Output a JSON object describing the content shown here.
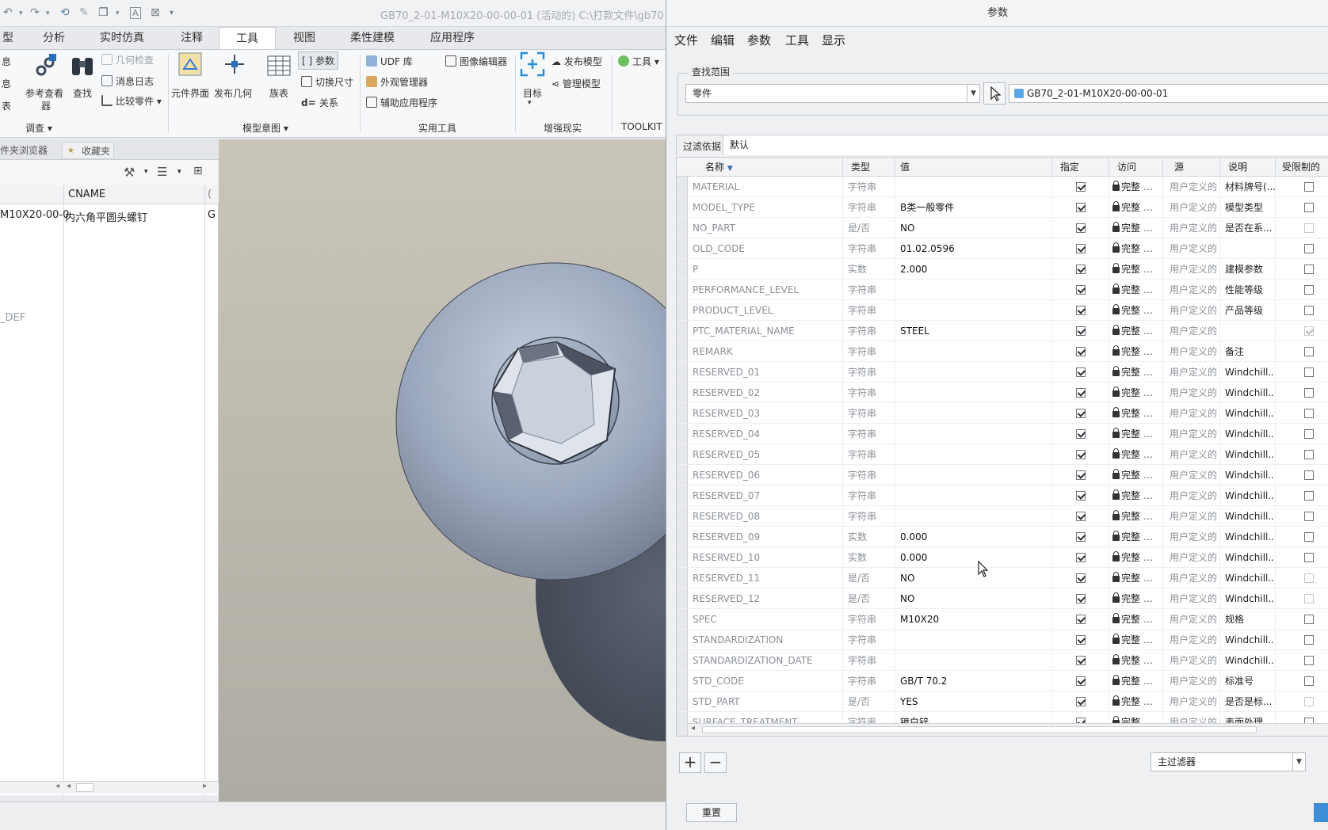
{
  "app": {
    "title": "GB70_2-01-M10X20-00-00-01 (活动的) C:\\打款文件\\gb70",
    "tabs": [
      {
        "label": "型"
      },
      {
        "label": "分析"
      },
      {
        "label": "实时仿真"
      },
      {
        "label": "注释"
      },
      {
        "label": "工具"
      },
      {
        "label": "视图"
      },
      {
        "label": "柔性建模"
      },
      {
        "label": "应用程序"
      }
    ],
    "ribbon": {
      "g1": {
        "item1": "息",
        "item2": "息",
        "item3": "表"
      },
      "investigate": {
        "ref_viewer_1": "参考查看",
        "ref_viewer_2": "器",
        "find": "查找",
        "geom_check": "几何检查",
        "msg_log": "消息日志",
        "compare": "比较零件",
        "label": "调查"
      },
      "model_intent": {
        "component_interface": "元件界面",
        "publish_geom": "发布几何",
        "family_table": "族表",
        "parameters": "参数",
        "switch_dims": "切换尺寸",
        "relations": "关系",
        "label": "模型意图"
      },
      "utilities": {
        "udf": "UDF 库",
        "appearance": "外观管理器",
        "aux_app": "辅助应用程序",
        "image_editor": "图像编辑器",
        "label": "实用工具"
      },
      "ar": {
        "target": "目标",
        "publish_model": "发布模型",
        "manage_model": "管理模型",
        "label": "增强现实"
      },
      "toolkit": {
        "tools": "工具",
        "label": "TOOLKIT"
      }
    },
    "navigator": {
      "tab1": "件夹浏览器",
      "tab2": "收藏夹",
      "col_cname": "CNAME",
      "row1_name": "M10X20-00-0",
      "row1_cname": "内六角平圆头螺钉",
      "row1_extra": "G",
      "row2_name": "_DEF"
    }
  },
  "dialog": {
    "title": "参数",
    "menu": [
      "文件",
      "编辑",
      "参数",
      "工具",
      "显示"
    ],
    "scope_label": "查找范围",
    "scope_value": "零件",
    "model_name": "GB70_2-01-M10X20-00-00-01",
    "filter_label": "过滤依据",
    "filter_value": "默认",
    "headers": {
      "name": "名称",
      "type": "类型",
      "value": "值",
      "designate": "指定",
      "access": "访问",
      "source": "源",
      "description": "说明",
      "restricted": "受限制的"
    },
    "access_text": "完整",
    "source_text": "用户定义的",
    "rows": [
      {
        "name": "MATERIAL",
        "type": "字符串",
        "value": "",
        "desc": "材料牌号(...",
        "restricted": false,
        "dim": false
      },
      {
        "name": "MODEL_TYPE",
        "type": "字符串",
        "value": "B类一般零件",
        "desc": "模型类型",
        "restricted": false,
        "dim": false
      },
      {
        "name": "NO_PART",
        "type": "是/否",
        "value": "NO",
        "desc": "是否在系...",
        "restricted": false,
        "dim": true
      },
      {
        "name": "OLD_CODE",
        "type": "字符串",
        "value": "01.02.0596",
        "desc": "",
        "restricted": false,
        "dim": false
      },
      {
        "name": "P",
        "type": "实数",
        "value": "2.000",
        "desc": "建模参数",
        "restricted": false,
        "dim": false
      },
      {
        "name": "PERFORMANCE_LEVEL",
        "type": "字符串",
        "value": "",
        "desc": "性能等级",
        "restricted": false,
        "dim": false
      },
      {
        "name": "PRODUCT_LEVEL",
        "type": "字符串",
        "value": "",
        "desc": "产品等级",
        "restricted": false,
        "dim": false
      },
      {
        "name": "PTC_MATERIAL_NAME",
        "type": "字符串",
        "value": "STEEL",
        "desc": "",
        "restricted": true,
        "dim": true
      },
      {
        "name": "REMARK",
        "type": "字符串",
        "value": "",
        "desc": "备注",
        "restricted": false,
        "dim": false
      },
      {
        "name": "RESERVED_01",
        "type": "字符串",
        "value": "",
        "desc": "Windchill...",
        "restricted": false,
        "dim": false
      },
      {
        "name": "RESERVED_02",
        "type": "字符串",
        "value": "",
        "desc": "Windchill...",
        "restricted": false,
        "dim": false
      },
      {
        "name": "RESERVED_03",
        "type": "字符串",
        "value": "",
        "desc": "Windchill...",
        "restricted": false,
        "dim": false
      },
      {
        "name": "RESERVED_04",
        "type": "字符串",
        "value": "",
        "desc": "Windchill...",
        "restricted": false,
        "dim": false
      },
      {
        "name": "RESERVED_05",
        "type": "字符串",
        "value": "",
        "desc": "Windchill...",
        "restricted": false,
        "dim": false
      },
      {
        "name": "RESERVED_06",
        "type": "字符串",
        "value": "",
        "desc": "Windchill...",
        "restricted": false,
        "dim": false
      },
      {
        "name": "RESERVED_07",
        "type": "字符串",
        "value": "",
        "desc": "Windchill...",
        "restricted": false,
        "dim": false
      },
      {
        "name": "RESERVED_08",
        "type": "字符串",
        "value": "",
        "desc": "Windchill...",
        "restricted": false,
        "dim": false
      },
      {
        "name": "RESERVED_09",
        "type": "实数",
        "value": "0.000",
        "desc": "Windchill...",
        "restricted": false,
        "dim": false
      },
      {
        "name": "RESERVED_10",
        "type": "实数",
        "value": "0.000",
        "desc": "Windchill...",
        "restricted": false,
        "dim": false
      },
      {
        "name": "RESERVED_11",
        "type": "是/否",
        "value": "NO",
        "desc": "Windchill...",
        "restricted": false,
        "dim": true
      },
      {
        "name": "RESERVED_12",
        "type": "是/否",
        "value": "NO",
        "desc": "Windchill...",
        "restricted": false,
        "dim": true
      },
      {
        "name": "SPEC",
        "type": "字符串",
        "value": "M10X20",
        "desc": "规格",
        "restricted": false,
        "dim": false
      },
      {
        "name": "STANDARDIZATION",
        "type": "字符串",
        "value": "",
        "desc": "Windchill...",
        "restricted": false,
        "dim": false
      },
      {
        "name": "STANDARDIZATION_DATE",
        "type": "字符串",
        "value": "",
        "desc": "Windchill...",
        "restricted": false,
        "dim": false
      },
      {
        "name": "STD_CODE",
        "type": "字符串",
        "value": "GB/T 70.2",
        "desc": "标准号",
        "restricted": false,
        "dim": false
      },
      {
        "name": "STD_PART",
        "type": "是/否",
        "value": "YES",
        "desc": "是否是标...",
        "restricted": false,
        "dim": true
      },
      {
        "name": "SURFACE_TREATMENT",
        "type": "字符串",
        "value": "镀白锌",
        "desc": "表面处理",
        "restricted": false,
        "dim": false
      }
    ],
    "main_filter": "主过滤器",
    "reset": "重置",
    "colors": {
      "accent": "#3c8fd6",
      "dim_text": "#8a8f96"
    }
  }
}
